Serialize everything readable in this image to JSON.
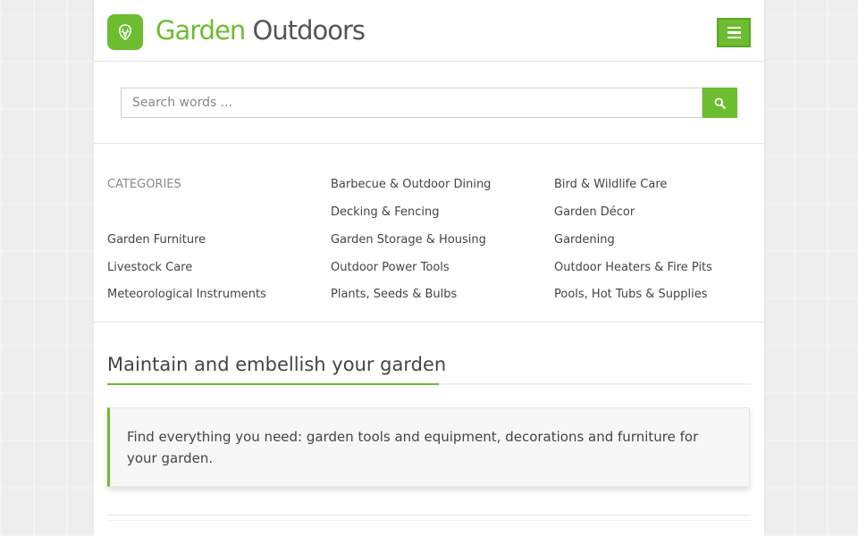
{
  "brand": {
    "name_part1": "Garden",
    "name_part2": "Outdoors",
    "accent_color": "#6cbd2f",
    "logo_icon": "lettuce-icon"
  },
  "header": {
    "menu_icon": "hamburger-menu-icon"
  },
  "search": {
    "placeholder": "Search words ...",
    "value": "",
    "button_icon": "search-icon"
  },
  "categories": {
    "heading": "CATEGORIES",
    "items": [
      "Barbecue & Outdoor Dining",
      "Bird & Wildlife Care",
      "Decking & Fencing",
      "Garden Décor",
      "Garden Furniture",
      "Garden Storage & Housing",
      "Gardening",
      "Livestock Care",
      "Outdoor Power Tools",
      "Outdoor Heaters & Fire Pits",
      "Meteorological Instruments",
      "Plants, Seeds & Bulbs",
      "Pools, Hot Tubs & Supplies"
    ]
  },
  "main": {
    "title": "Maintain and embellish your garden",
    "intro": "Find everything you need: garden tools and equipment, decorations and furniture for your garden."
  }
}
